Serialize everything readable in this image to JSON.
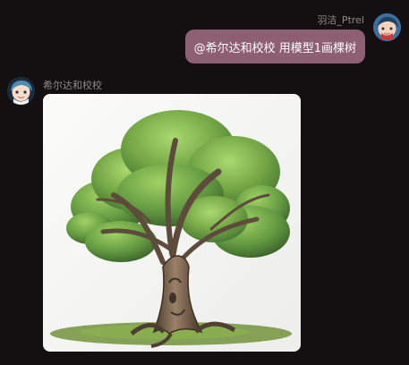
{
  "messages": {
    "outgoing": {
      "username": "羽洁_Ptrel",
      "text": "@希尔达和校校 用模型1画棵树"
    },
    "incoming": {
      "username": "希尔达和校校",
      "image": "generated tree image"
    }
  },
  "colors": {
    "background": "#141011",
    "bubble": "#8e5f73",
    "secondary_text": "#8f8a8c"
  }
}
